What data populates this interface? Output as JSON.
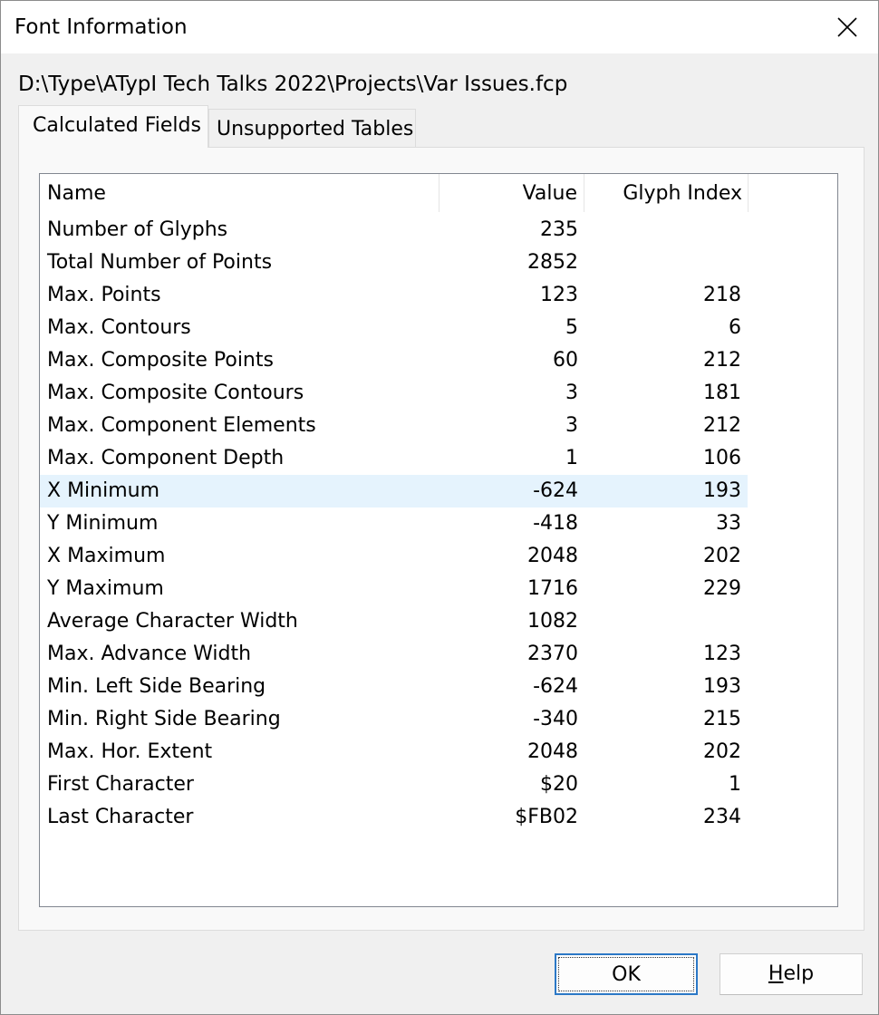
{
  "window": {
    "title": "Font Information",
    "close_label": "Close"
  },
  "file_path": "D:\\Type\\ATypI Tech Talks 2022\\Projects\\Var Issues.fcp",
  "tabs": [
    {
      "label": "Calculated Fields",
      "active": true
    },
    {
      "label": "Unsupported Tables",
      "active": false
    }
  ],
  "table": {
    "columns": [
      "Name",
      "Value",
      "Glyph Index"
    ],
    "selected_row": "X Minimum",
    "rows": [
      {
        "name": "Number of Glyphs",
        "value": "235",
        "glyph": ""
      },
      {
        "name": "Total Number of Points",
        "value": "2852",
        "glyph": ""
      },
      {
        "name": "Max. Points",
        "value": "123",
        "glyph": "218"
      },
      {
        "name": "Max. Contours",
        "value": "5",
        "glyph": "6"
      },
      {
        "name": "Max. Composite Points",
        "value": "60",
        "glyph": "212"
      },
      {
        "name": "Max. Composite Contours",
        "value": "3",
        "glyph": "181"
      },
      {
        "name": "Max. Component Elements",
        "value": "3",
        "glyph": "212"
      },
      {
        "name": "Max. Component Depth",
        "value": "1",
        "glyph": "106"
      },
      {
        "name": "X Minimum",
        "value": "-624",
        "glyph": "193"
      },
      {
        "name": "Y Minimum",
        "value": "-418",
        "glyph": "33"
      },
      {
        "name": "X Maximum",
        "value": "2048",
        "glyph": "202"
      },
      {
        "name": "Y Maximum",
        "value": "1716",
        "glyph": "229"
      },
      {
        "name": "Average Character Width",
        "value": "1082",
        "glyph": ""
      },
      {
        "name": "Max. Advance Width",
        "value": "2370",
        "glyph": "123"
      },
      {
        "name": "Min. Left Side Bearing",
        "value": "-624",
        "glyph": "193"
      },
      {
        "name": "Min. Right Side Bearing",
        "value": "-340",
        "glyph": "215"
      },
      {
        "name": "Max. Hor. Extent",
        "value": "2048",
        "glyph": "202"
      },
      {
        "name": "First Character",
        "value": "$20",
        "glyph": "1"
      },
      {
        "name": "Last Character",
        "value": "$FB02",
        "glyph": "234"
      }
    ]
  },
  "buttons": {
    "ok": "OK",
    "help_mnemonic": "H",
    "help_rest": "elp"
  },
  "colors": {
    "selection": "#e5f3fd",
    "default_button_border": "#2b78c6",
    "dialog_background": "#f0f0f0"
  }
}
